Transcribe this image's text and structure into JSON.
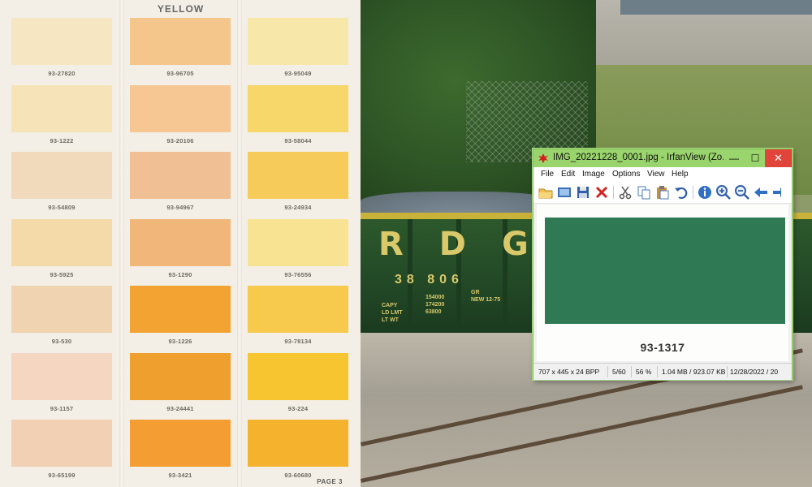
{
  "chart": {
    "title": "YELLOW",
    "page_label": "PAGE 3",
    "columns": [
      [
        {
          "code": "93-27820",
          "color": "#f6e6c1"
        },
        {
          "code": "93-1222",
          "color": "#f6e3b8"
        },
        {
          "code": "93-54809",
          "color": "#f1d9bb"
        },
        {
          "code": "93-5925",
          "color": "#f4d9a9"
        },
        {
          "code": "93-530",
          "color": "#f0d3b0"
        },
        {
          "code": "93-1157",
          "color": "#f4d6c1"
        },
        {
          "code": "93-65199",
          "color": "#f2d0b4"
        }
      ],
      [
        {
          "code": "93-96705",
          "color": "#f5c68c"
        },
        {
          "code": "93-20106",
          "color": "#f6c792"
        },
        {
          "code": "93-94967",
          "color": "#f0bf93"
        },
        {
          "code": "93-1290",
          "color": "#f0b67a"
        },
        {
          "code": "93-1226",
          "color": "#f2a332"
        },
        {
          "code": "93-24441",
          "color": "#ee9f2d"
        },
        {
          "code": "93-3421",
          "color": "#f39d32"
        }
      ],
      [
        {
          "code": "93-95049",
          "color": "#f7e7a9"
        },
        {
          "code": "93-58044",
          "color": "#f7d66a"
        },
        {
          "code": "93-24934",
          "color": "#f6cb5a"
        },
        {
          "code": "93-76556",
          "color": "#f8e393"
        },
        {
          "code": "93-78134",
          "color": "#f7c94d"
        },
        {
          "code": "93-224",
          "color": "#f6c530"
        },
        {
          "code": "93-60680",
          "color": "#f5b22d"
        }
      ]
    ]
  },
  "photo": {
    "reporting_mark": "RDG",
    "car_number": "38 806",
    "stencil_left": [
      "CAPY",
      "LD LMT",
      "LT WT"
    ],
    "stencil_mid": [
      "154000",
      "174200",
      "63800"
    ],
    "stencil_right": [
      "GR",
      "NEW 12-75"
    ]
  },
  "window": {
    "title": "IMG_20221228_0001.jpg - IrfanView (Zo...",
    "minimize": "—",
    "maximize": "☐",
    "close": "✕",
    "menu": [
      "File",
      "Edit",
      "Image",
      "Options",
      "View",
      "Help"
    ],
    "toolbar": [
      "open-folder",
      "slideshow",
      "save",
      "delete",
      "cut",
      "copy",
      "paste",
      "undo",
      "info",
      "zoom-in",
      "zoom-out",
      "previous"
    ],
    "image": {
      "swatch_color": "#2f7a55",
      "code": "93-1317"
    },
    "status": {
      "dimensions": "707 x 445 x 24 BPP",
      "index": "5/60",
      "zoom": "56 %",
      "size": "1.04 MB / 923.07 KB",
      "date": "12/28/2022 / 20"
    }
  }
}
